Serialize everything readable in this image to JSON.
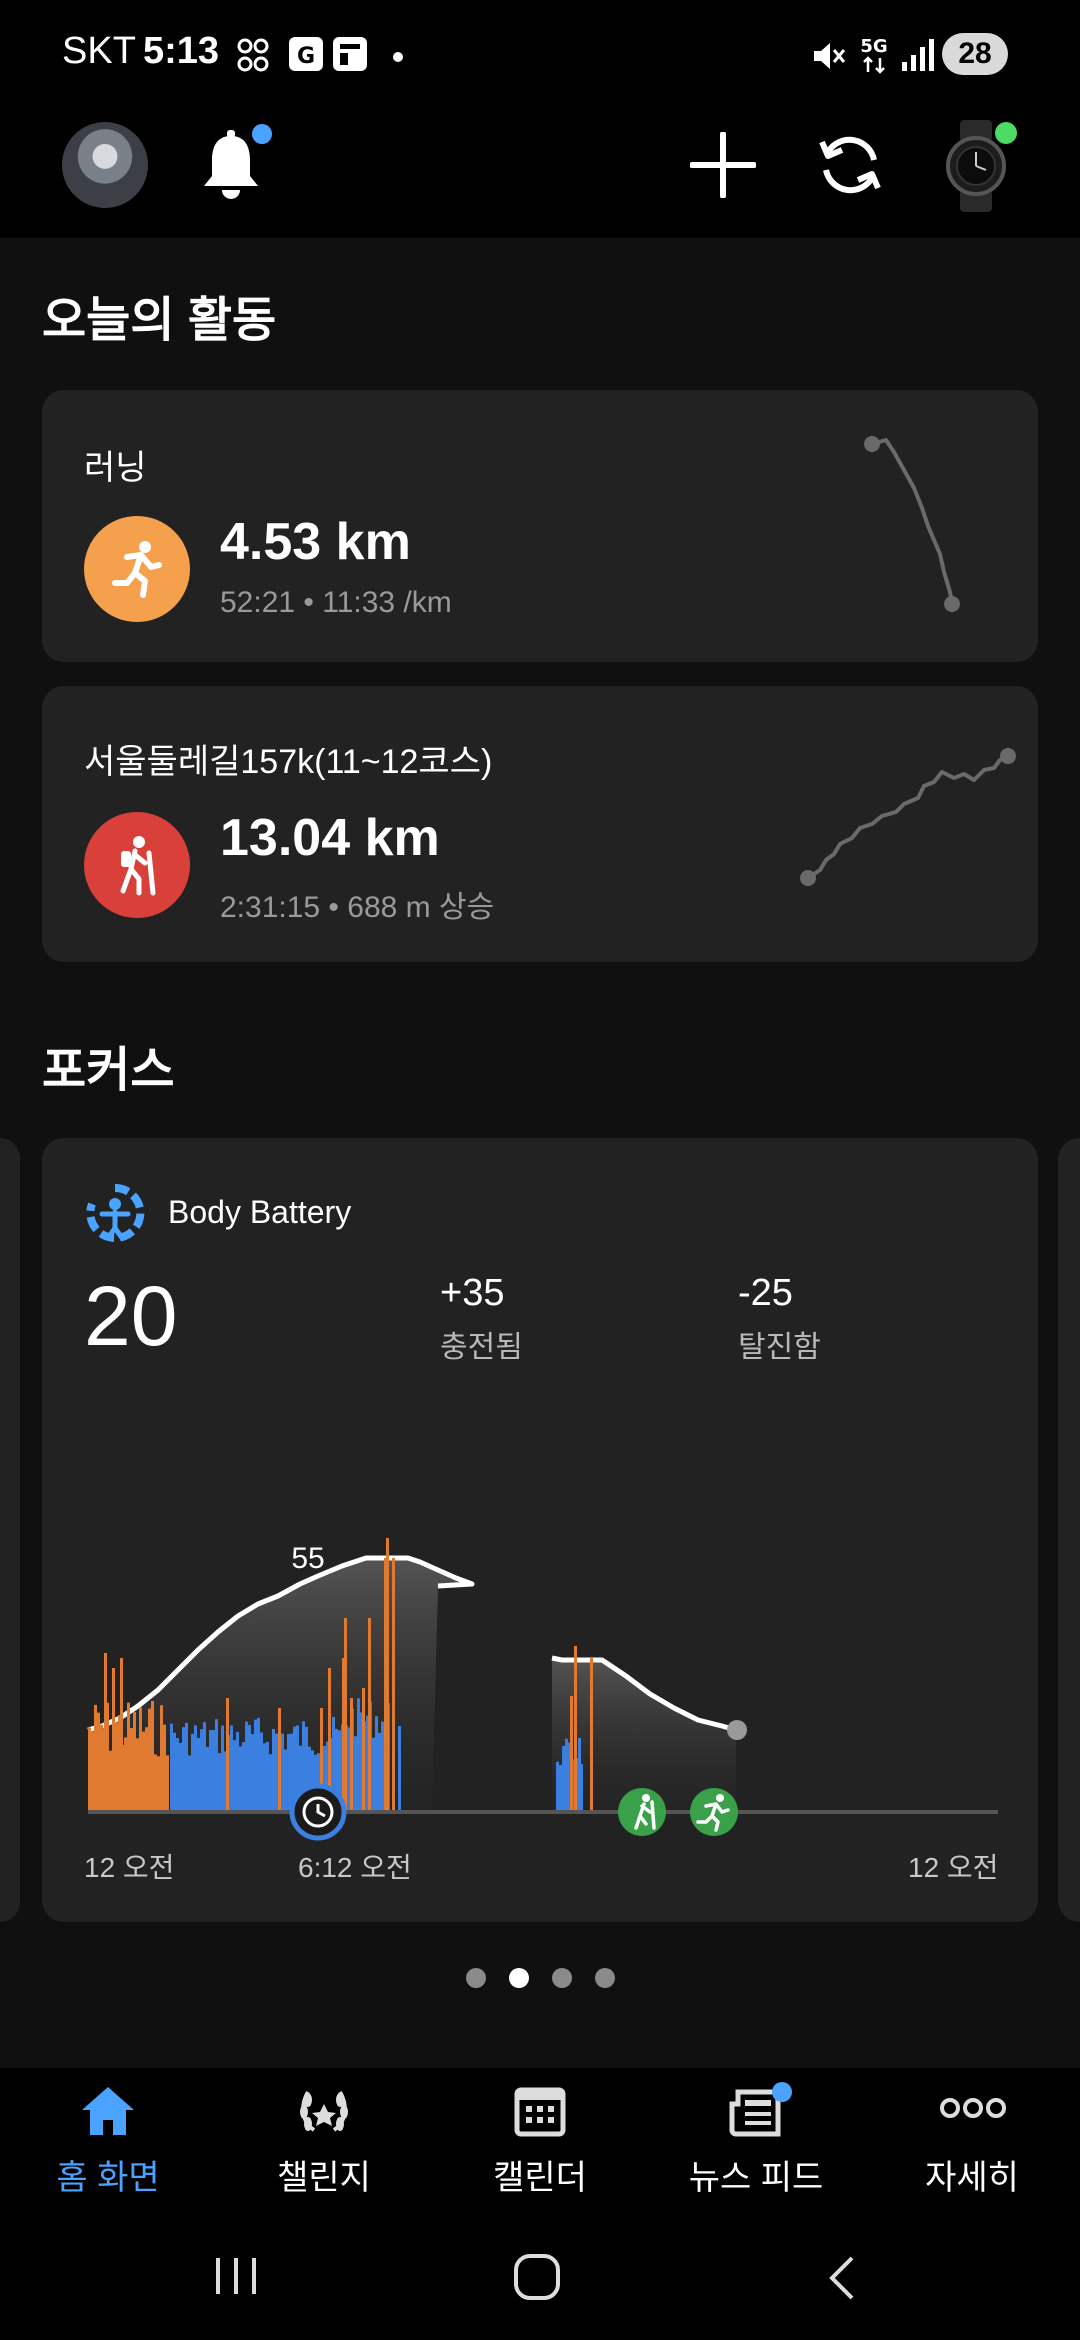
{
  "status": {
    "carrier": "SKT",
    "time": "5:13",
    "battery": "28"
  },
  "today": {
    "title": "오늘의 활동",
    "activities": [
      {
        "label": "러닝",
        "distance": "4.53 km",
        "sub": "52:21 • 11:33 /km",
        "icon": "running-icon",
        "color": "#f4a04c"
      },
      {
        "label": "서울둘레길157k(11~12코스)",
        "distance": "13.04 km",
        "sub": "2:31:15 • 688 m 상승",
        "icon": "hiking-icon",
        "color": "#d9403a"
      }
    ]
  },
  "focus": {
    "title": "포커스",
    "body_battery": {
      "title": "Body Battery",
      "value": "20",
      "charged_value": "+35",
      "charged_label": "충전됨",
      "drained_value": "-25",
      "drained_label": "탈진함",
      "peak_label": "55",
      "x_labels": [
        "12 오전",
        "6:12 오전",
        "12 오전"
      ]
    }
  },
  "pager": {
    "count": 4,
    "active_index": 1
  },
  "nav": {
    "items": [
      {
        "label": "홈 화면",
        "icon": "home-icon",
        "active": true
      },
      {
        "label": "챌린지",
        "icon": "laurel-icon",
        "active": false
      },
      {
        "label": "캘린더",
        "icon": "calendar-icon",
        "active": false
      },
      {
        "label": "뉴스 피드",
        "icon": "news-icon",
        "active": false
      },
      {
        "label": "자세히",
        "icon": "more-icon",
        "active": false
      }
    ]
  },
  "colors": {
    "accent": "#4aa3ff",
    "run": "#f4a04c",
    "hike": "#d9403a",
    "sleep": "#3b7fe0",
    "stress": "#e07a30",
    "activity_marker": "#3aa14a"
  }
}
